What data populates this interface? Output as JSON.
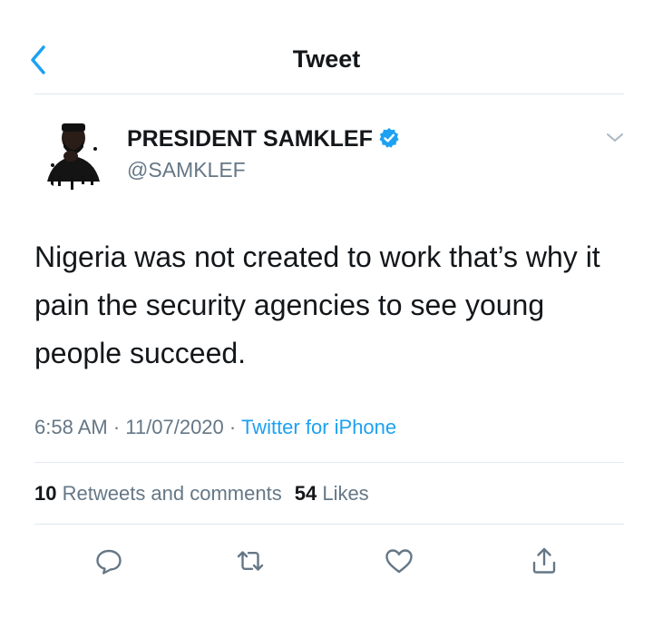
{
  "header": {
    "title": "Tweet"
  },
  "author": {
    "display_name": "PRESIDENT SAMKLEF",
    "handle": "@SAMKLEF",
    "verified": true
  },
  "tweet": {
    "text": "Nigeria was not created to work that’s why it pain the security agencies to see young people succeed."
  },
  "meta": {
    "time": "6:58 AM",
    "date": "11/07/2020",
    "separator": "·",
    "source": "Twitter for iPhone"
  },
  "stats": {
    "retweets_count": "10",
    "retweets_label": "Retweets and comments",
    "likes_count": "54",
    "likes_label": "Likes"
  },
  "actions": [
    "reply-icon",
    "retweet-icon",
    "like-icon",
    "share-icon"
  ],
  "colors": {
    "accent": "#1da1f2",
    "text": "#14171a",
    "secondary": "#657786",
    "divider": "#e1e8ed"
  }
}
